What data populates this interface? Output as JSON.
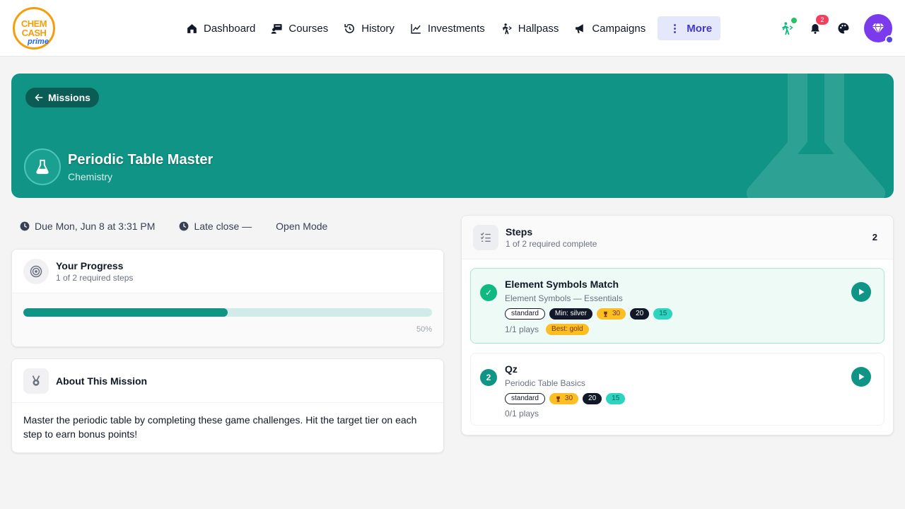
{
  "brand": {
    "line1": "CHEM",
    "line2": "CASH",
    "line3": "prime"
  },
  "nav": {
    "items": [
      {
        "label": "Dashboard",
        "icon": "home-icon"
      },
      {
        "label": "Courses",
        "icon": "courses-icon"
      },
      {
        "label": "History",
        "icon": "history-icon"
      },
      {
        "label": "Investments",
        "icon": "chart-icon"
      },
      {
        "label": "Hallpass",
        "icon": "walking-icon"
      },
      {
        "label": "Campaigns",
        "icon": "megaphone-icon"
      }
    ],
    "more_label": "More"
  },
  "header_tools": {
    "notifications_count": "2"
  },
  "hero": {
    "back_label": "Missions",
    "title": "Periodic Table Master",
    "subject": "Chemistry",
    "color": "#0f9486"
  },
  "meta": {
    "due": "Due Mon, Jun 8 at 3:31 PM",
    "late_close": "Late close —",
    "mode": "Open Mode"
  },
  "progress": {
    "title": "Your Progress",
    "subtitle": "1 of 2 required steps",
    "fraction": 0.5,
    "percent_label": "50%"
  },
  "about": {
    "title": "About This Mission",
    "text": "Master the periodic table by completing these game challenges. Hit the target tier on each step to earn bonus points!"
  },
  "steps": {
    "title": "Steps",
    "subtitle": "1 of 2 required complete",
    "count": "2",
    "items": [
      {
        "num": "✓",
        "title": "Element Symbols Match",
        "subtitle": "Element Symbols — Essentials",
        "mode": "standard",
        "min_tier": "Min: silver",
        "points": "30",
        "stat_a": "20",
        "stat_b": "15",
        "plays": "1/1 plays",
        "best": "Best: gold"
      },
      {
        "num": "2",
        "title": "Qz",
        "subtitle": "Periodic Table Basics",
        "mode": "standard",
        "points": "30",
        "stat_a": "20",
        "stat_b": "15",
        "plays": "0/1 plays"
      }
    ]
  },
  "colors": {
    "accent": "#0f9486",
    "complete": "#10b981",
    "purple": "#7c3aed"
  }
}
